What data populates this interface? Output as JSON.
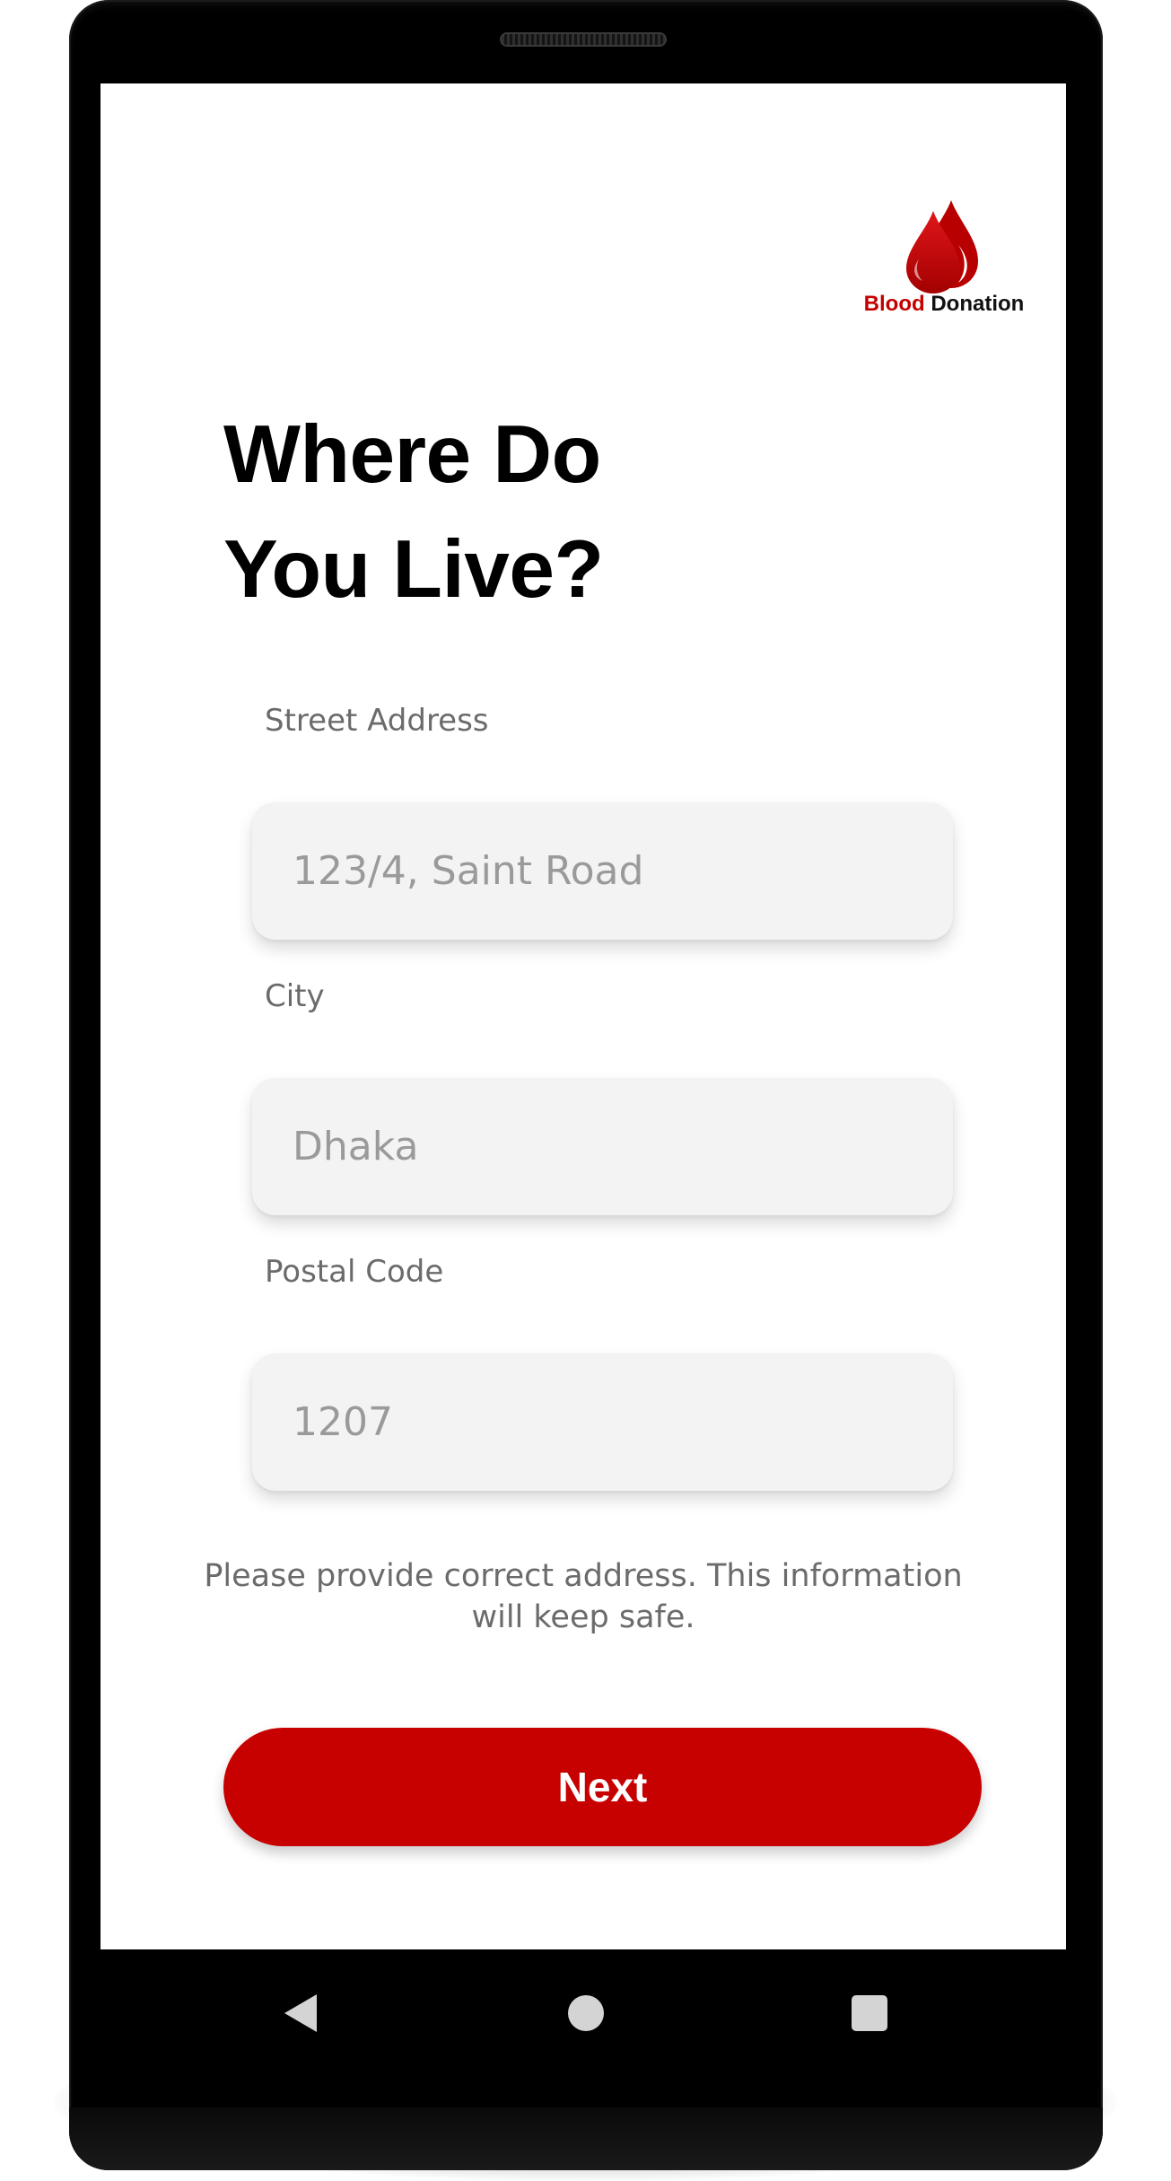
{
  "app": {
    "logo": {
      "brand_red": "Blood",
      "brand_dark": "Donation",
      "icon": "blood-drops-icon"
    }
  },
  "page": {
    "title_line1": "Where Do",
    "title_line2": "You Live?"
  },
  "form": {
    "street": {
      "label": "Street Address",
      "placeholder": "123/4, Saint Road"
    },
    "city": {
      "label": "City",
      "placeholder": "Dhaka"
    },
    "postal": {
      "label": "Postal Code",
      "placeholder": "1207"
    },
    "helper_text": "Please provide correct address. This information will keep safe."
  },
  "actions": {
    "next_label": "Next"
  },
  "nav": {
    "back_icon": "back-triangle-icon",
    "home_icon": "home-circle-icon",
    "recents_icon": "recents-square-icon"
  },
  "colors": {
    "accent": "#c70000",
    "field_background": "#f3f3f3",
    "label_text": "#6b6b6b",
    "title_text": "#000000",
    "device_frame": "#000000"
  }
}
